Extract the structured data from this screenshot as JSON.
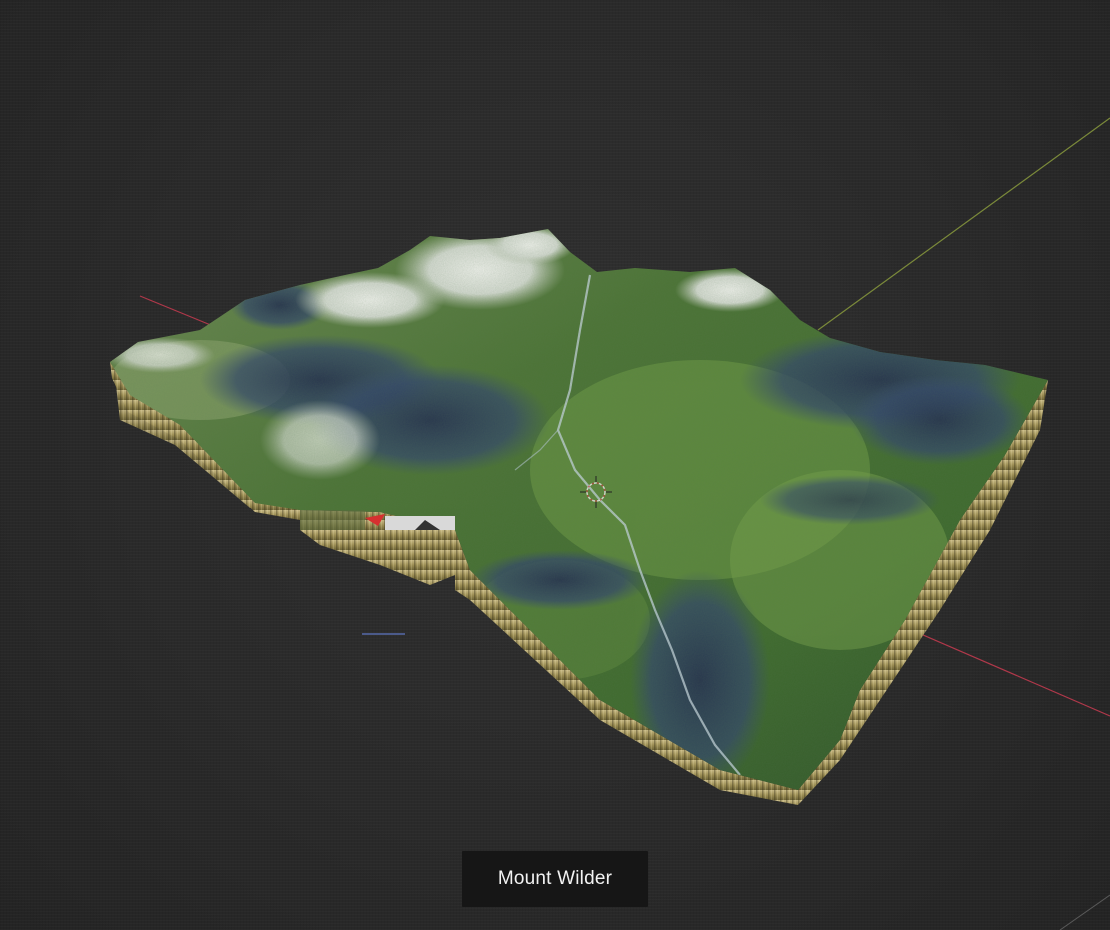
{
  "viewport": {
    "background": "#2b2b2b",
    "axis_colors": {
      "x_axis": "#b0384a",
      "y_axis": "#7b8a3a"
    }
  },
  "terrain": {
    "colors": {
      "forest": "#4f7a34",
      "forest_dark": "#2c4a2a",
      "shadow": "#2e3d5a",
      "snow": "#dfe3e0",
      "side_wall": "#a89b5e"
    }
  },
  "caption": {
    "label": "Mount Wilder"
  }
}
